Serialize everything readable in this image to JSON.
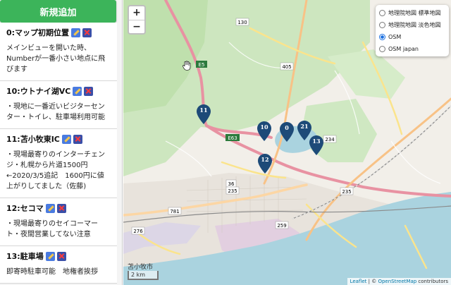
{
  "sidebar": {
    "add_button": "新規追加",
    "spots": [
      {
        "title": "0:マップ初期位置",
        "desc": "メインビューを開いた時、Numberが一番小さい地点に飛びます"
      },
      {
        "title": "10:ウトナイ湖VC",
        "desc": "・現地に一番近いビジターセンター・トイレ、駐車場利用可能"
      },
      {
        "title": "11:苫小牧東IC",
        "desc": "・現場最寄りのインターチェンジ・札幌から片道1500円←2020/3/5追記　1600円に値上がりしてました（佐藤)"
      },
      {
        "title": "12:セコマ",
        "desc": "・現場最寄りのセイコーマート・夜間営業してない注意"
      },
      {
        "title": "13:駐車場",
        "desc": "即寄時駐車可能　地権者挨拶"
      }
    ]
  },
  "map": {
    "zoom_in": "+",
    "zoom_out": "−",
    "layers": [
      {
        "label": "地理院地図 標準地図",
        "selected": false
      },
      {
        "label": "地理院地図 淡色地図",
        "selected": false
      },
      {
        "label": "OSM",
        "selected": true
      },
      {
        "label": "OSM japan",
        "selected": false
      }
    ],
    "markers": [
      "11",
      "10",
      "0",
      "21",
      "13",
      "12"
    ],
    "city_label": "苫小牧市",
    "scale": "2 km",
    "attribution_leaflet": "Leaflet",
    "attribution_sep": " | © ",
    "attribution_osm": "OpenStreetMap",
    "attribution_tail": " contributors",
    "road_labels": [
      "130",
      "E5",
      "405",
      "E63",
      "36",
      "235",
      "234",
      "781",
      "259",
      "276",
      "235"
    ],
    "marker_color": "#1d4a78"
  }
}
